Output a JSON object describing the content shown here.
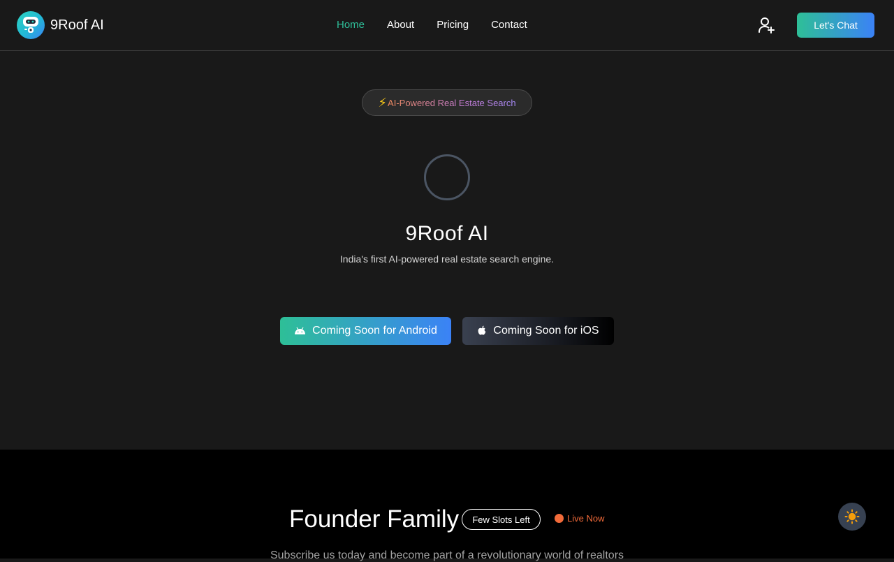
{
  "header": {
    "brand_name": "9Roof AI",
    "nav": [
      {
        "label": "Home",
        "active": true
      },
      {
        "label": "About",
        "active": false
      },
      {
        "label": "Pricing",
        "active": false
      },
      {
        "label": "Contact",
        "active": false
      }
    ],
    "user_icon": "user-plus-icon",
    "cta_label": "Let's Chat"
  },
  "hero": {
    "badge_icon": "lightning-bolt-icon",
    "badge_text": "AI-Powered Real Estate Search",
    "title": "9Roof AI",
    "subtitle": "India's first AI-powered real estate search engine.",
    "android_label": "Coming Soon for Android",
    "ios_label": "Coming Soon for iOS"
  },
  "founder": {
    "title": "Founder Family",
    "badge": "Few Slots Left",
    "live_label": "Live Now",
    "subtitle": "Subscribe us today and become part of a revolutionary world of realtors"
  },
  "theme_toggle_icon": "sun-icon",
  "colors": {
    "accent_green": "#2ebf97",
    "accent_blue": "#3b82f6",
    "live_orange": "#f26b3a",
    "background": "#191919"
  }
}
